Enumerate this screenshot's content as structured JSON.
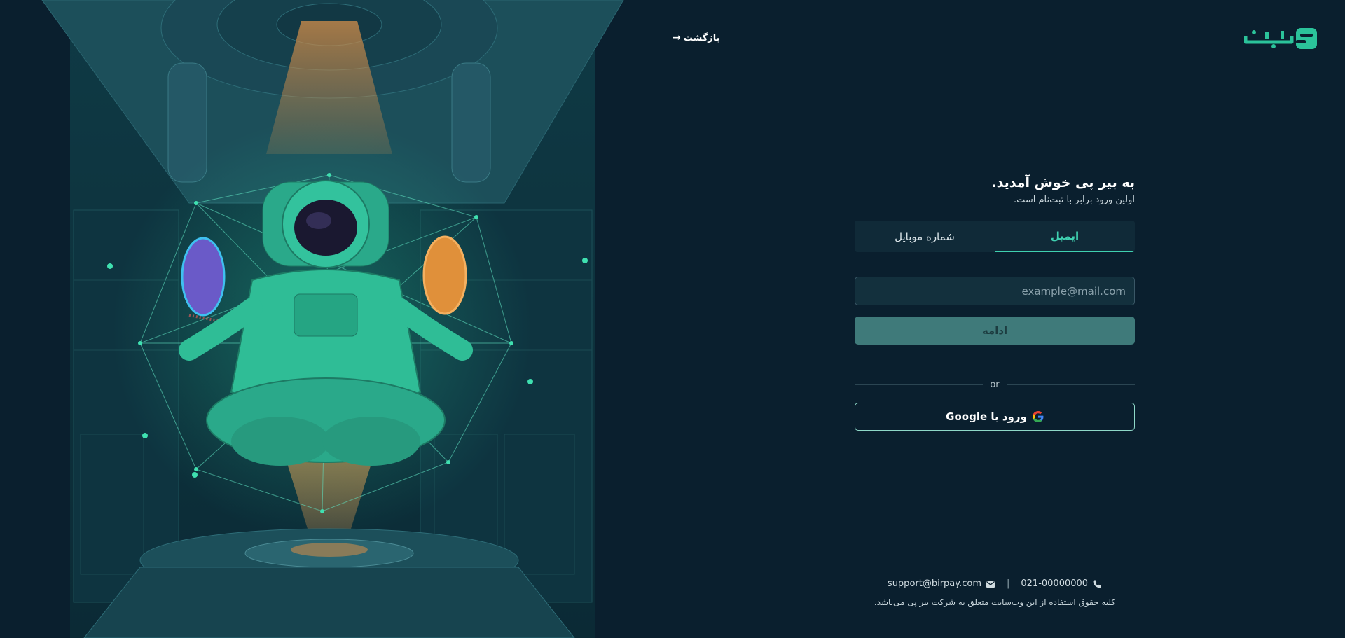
{
  "header": {
    "back_label": "بازگشت",
    "logo_alt": "birpay-logo"
  },
  "welcome": {
    "title": "به بیر پی خوش آمدید.",
    "subtitle": "اولین ورود برابر با ثبت‌نام است."
  },
  "tabs": [
    {
      "label": "ایمیل",
      "active": true
    },
    {
      "label": "شماره موبایل",
      "active": false
    }
  ],
  "email_input": {
    "placeholder": "example@mail.com",
    "value": ""
  },
  "continue_label": "ادامه",
  "divider_label": "or",
  "google_label": "ورود با Google",
  "footer": {
    "phone": "021-00000000",
    "separator": "|",
    "email": "support@birpay.com",
    "copyright": "کلیه حقوق استفاده از این وب‌سایت متعلق به شرکت بیر پی می‌باشد."
  },
  "colors": {
    "background": "#0a1f2e",
    "accent": "#3fd0b0",
    "button": "#3f7a7a"
  },
  "icons": {
    "phone": "phone-icon",
    "mail": "mail-icon",
    "google": "google-icon",
    "back": "arrow-right-icon"
  }
}
